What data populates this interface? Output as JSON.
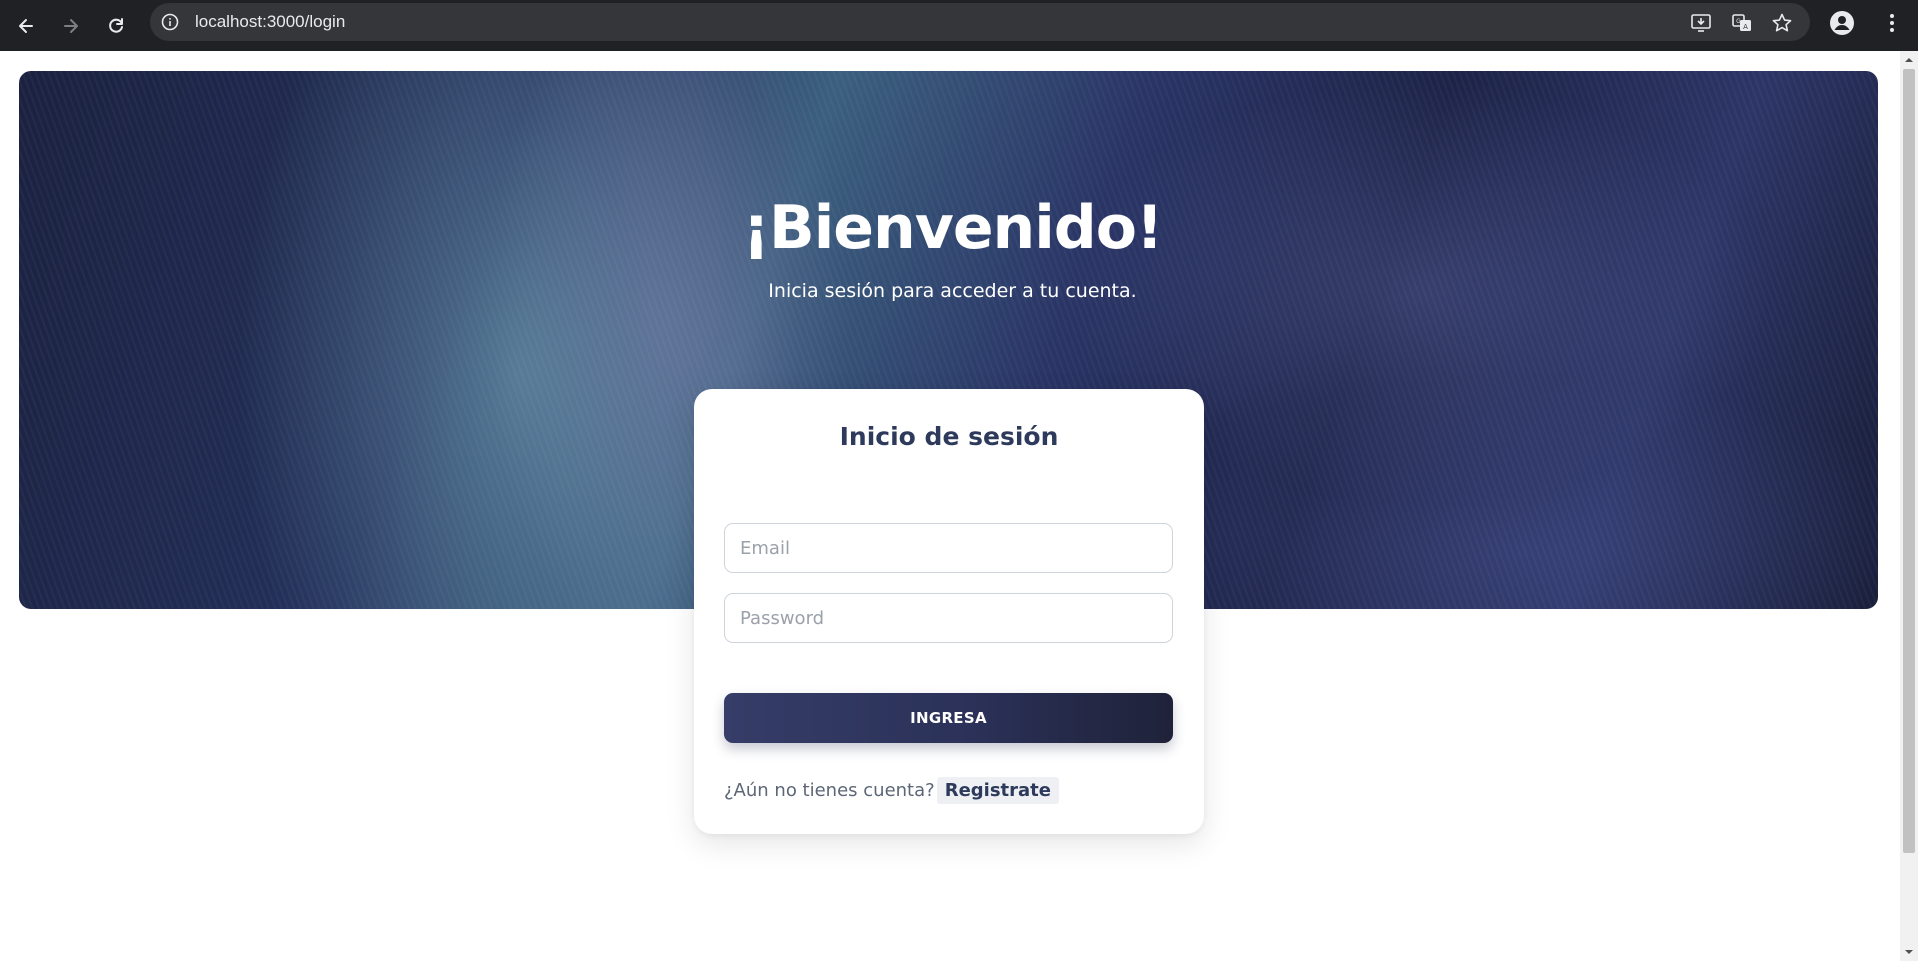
{
  "browser": {
    "url": "localhost:3000/login",
    "icons": {
      "back": "arrow-left-icon",
      "forward": "arrow-right-icon",
      "reload": "reload-icon",
      "site_info": "info-icon",
      "install": "install-app-icon",
      "translate": "translate-icon",
      "bookmark": "star-icon",
      "profile": "person-icon",
      "menu": "more-vertical-icon"
    },
    "colors": {
      "bar": "#202124",
      "omnibox": "#35363a",
      "text": "#e8eaed"
    }
  },
  "hero": {
    "title": "¡Bienvenido!",
    "subtitle": "Inicia sesión para acceder a tu cuenta."
  },
  "login": {
    "title": "Inicio de sesión",
    "email_placeholder": "Email",
    "password_placeholder": "Password",
    "submit_label": "INGRESA",
    "register_prompt": "¿Aún no tienes cuenta?",
    "register_link": "Registrate",
    "colors": {
      "title": "#2d3a5c",
      "button_start": "#353d68",
      "button_end": "#1f2239"
    }
  }
}
